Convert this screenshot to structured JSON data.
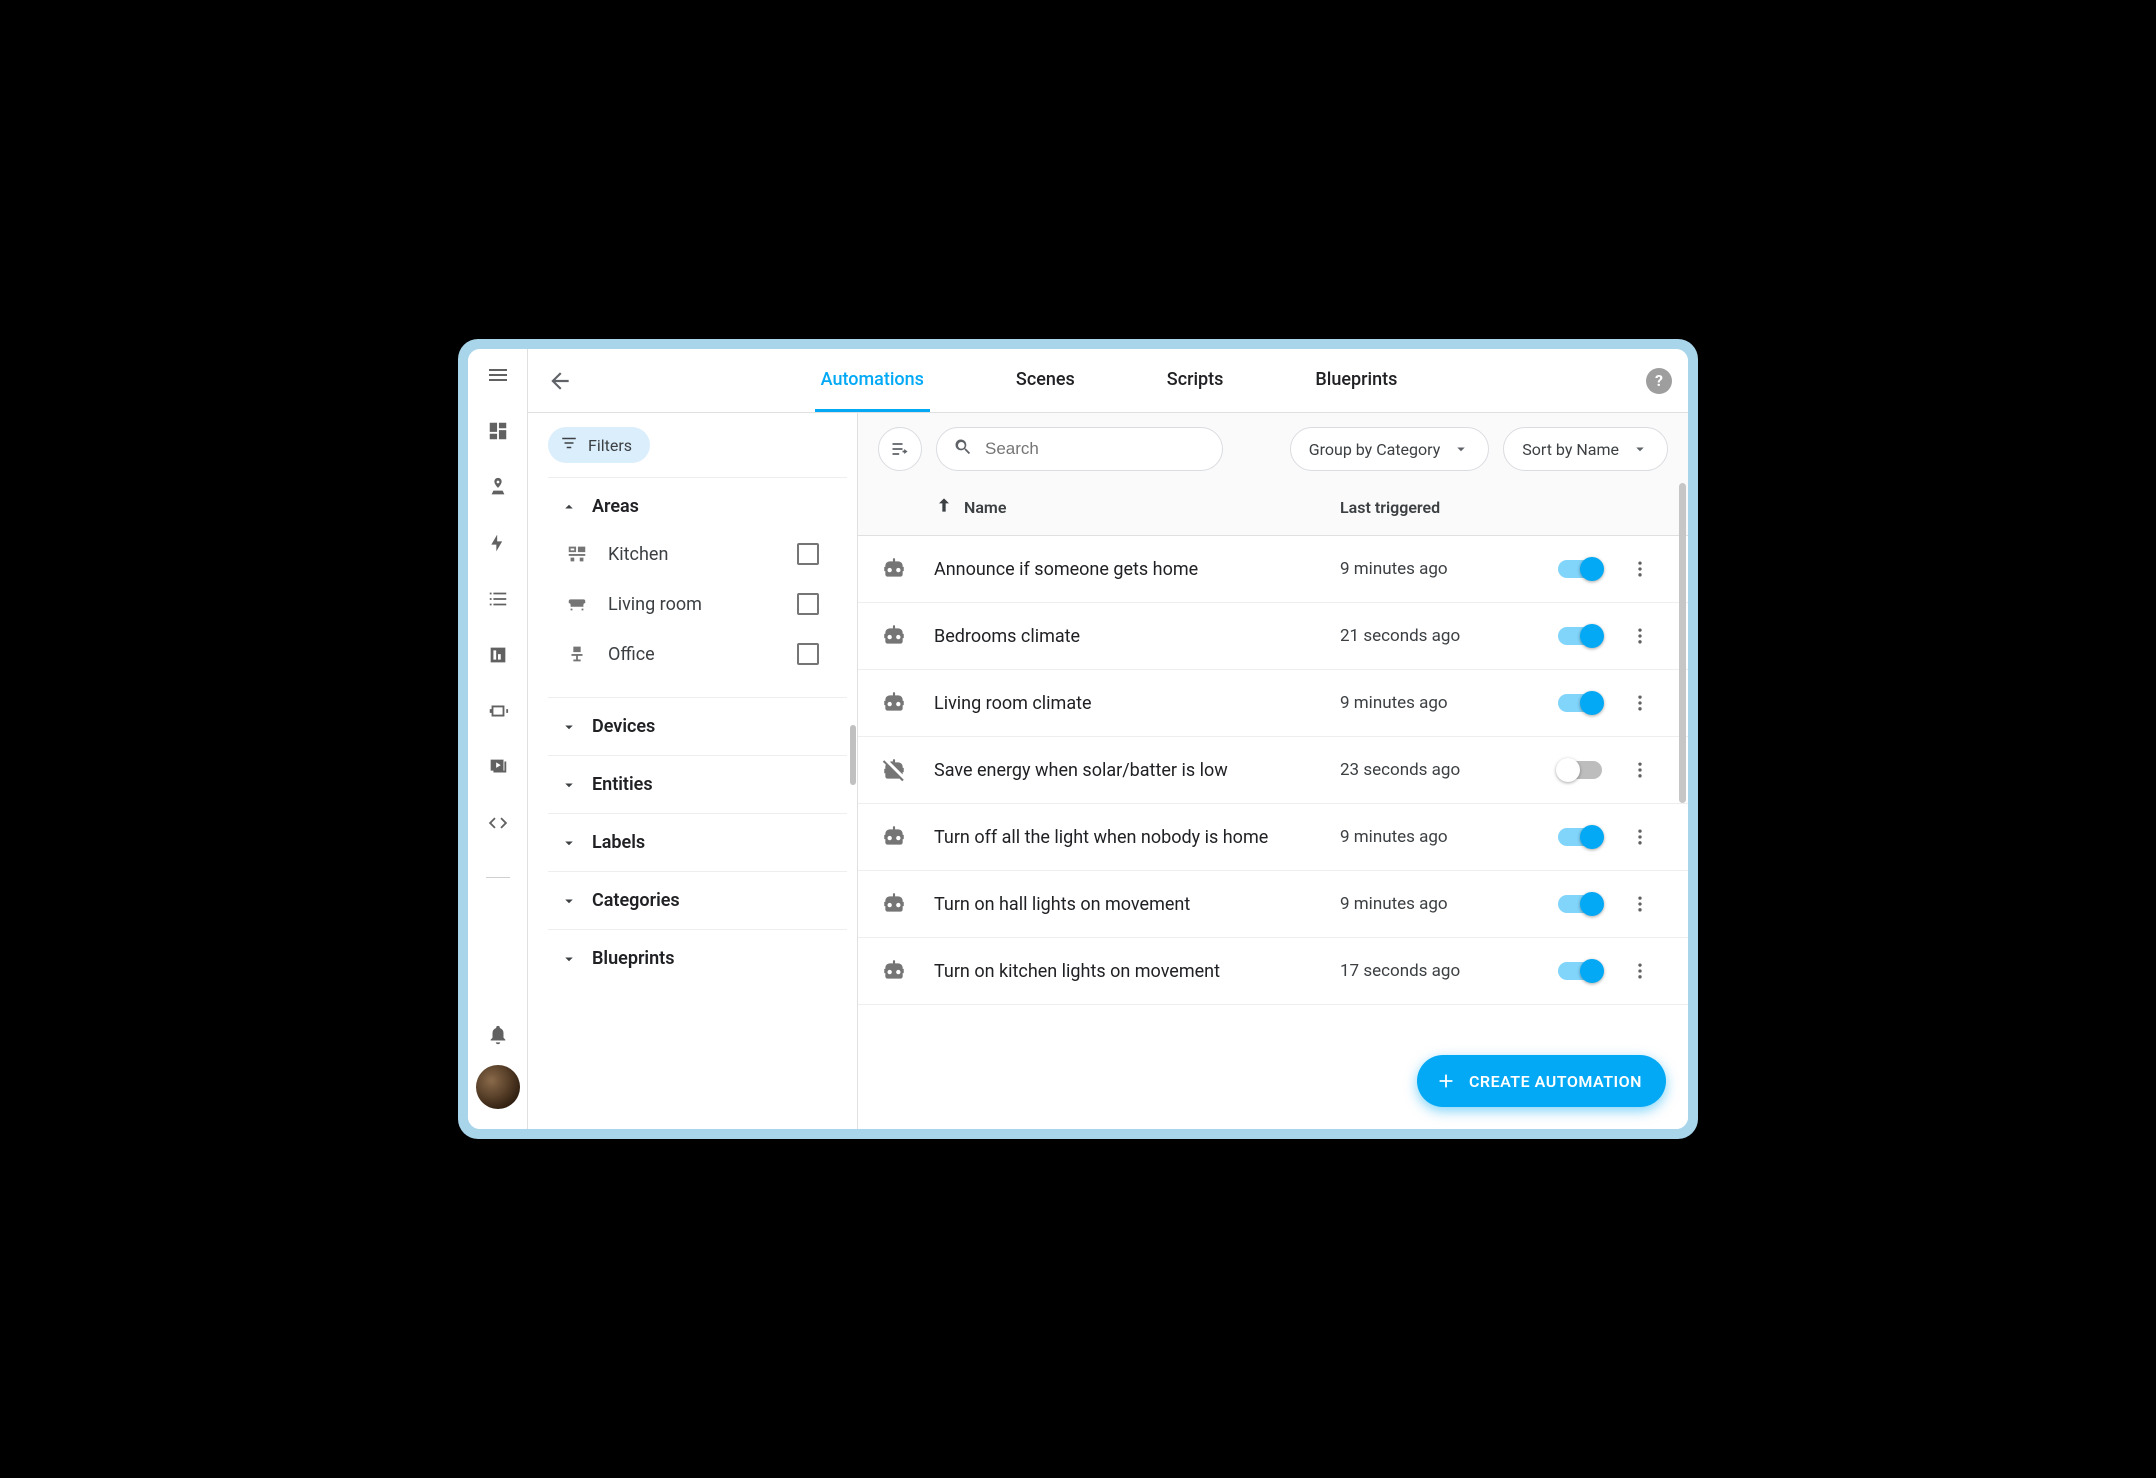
{
  "tabs": {
    "items": [
      {
        "label": "Automations",
        "active": true
      },
      {
        "label": "Scenes",
        "active": false
      },
      {
        "label": "Scripts",
        "active": false
      },
      {
        "label": "Blueprints",
        "active": false
      }
    ]
  },
  "sidebar": {
    "filters_label": "Filters",
    "sections": {
      "areas": {
        "label": "Areas",
        "expanded": true,
        "items": [
          {
            "label": "Kitchen",
            "icon": "counter-icon",
            "checked": false
          },
          {
            "label": "Living room",
            "icon": "sofa-icon",
            "checked": false
          },
          {
            "label": "Office",
            "icon": "desk-chair-icon",
            "checked": false
          }
        ]
      },
      "devices": {
        "label": "Devices",
        "expanded": false
      },
      "entities": {
        "label": "Entities",
        "expanded": false
      },
      "labels": {
        "label": "Labels",
        "expanded": false
      },
      "categories": {
        "label": "Categories",
        "expanded": false
      },
      "blueprints": {
        "label": "Blueprints",
        "expanded": false
      }
    }
  },
  "toolbar": {
    "search_placeholder": "Search",
    "group_by_label": "Group by Category",
    "sort_by_label": "Sort by Name"
  },
  "table": {
    "columns": {
      "name": "Name",
      "last_triggered": "Last triggered"
    },
    "sort_column": "name",
    "sort_dir": "asc"
  },
  "automations": [
    {
      "name": "Announce if someone gets home",
      "last_triggered": "9 minutes ago",
      "enabled": true,
      "icon": "robot"
    },
    {
      "name": "Bedrooms climate",
      "last_triggered": "21 seconds ago",
      "enabled": true,
      "icon": "robot"
    },
    {
      "name": "Living room climate",
      "last_triggered": "9 minutes ago",
      "enabled": true,
      "icon": "robot"
    },
    {
      "name": "Save energy when solar/batter is low",
      "last_triggered": "23 seconds ago",
      "enabled": false,
      "icon": "robot-off"
    },
    {
      "name": "Turn off all the light when nobody is home",
      "last_triggered": "9 minutes ago",
      "enabled": true,
      "icon": "robot"
    },
    {
      "name": "Turn on hall lights on movement",
      "last_triggered": "9 minutes ago",
      "enabled": true,
      "icon": "robot"
    },
    {
      "name": "Turn on kitchen lights on movement",
      "last_triggered": "17 seconds ago",
      "enabled": true,
      "icon": "robot"
    }
  ],
  "fab": {
    "label": "CREATE AUTOMATION"
  }
}
